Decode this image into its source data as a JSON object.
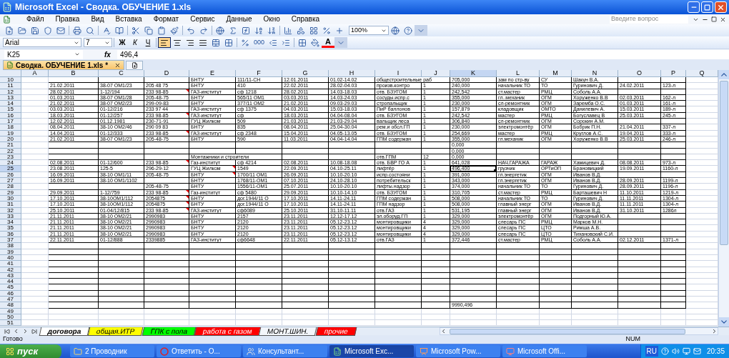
{
  "window": {
    "title": "Microsoft Excel - Сводка. ОБУЧЕНИЕ 1.xls"
  },
  "menu": [
    "Файл",
    "Правка",
    "Вид",
    "Вставка",
    "Формат",
    "Сервис",
    "Данные",
    "Окно",
    "Справка"
  ],
  "help_field": {
    "placeholder": "Введите вопрос"
  },
  "toolbar": {
    "zoom": "100%"
  },
  "format_toolbar": {
    "font": "Arial",
    "size": "7",
    "bold": "Ж",
    "italic": "К",
    "underline": "Ч",
    "thousands": "000",
    "font_color": "A",
    "align_buttons": [
      {
        "selected": true
      },
      {
        "selected": false
      },
      {
        "selected": false
      },
      {
        "selected": false
      }
    ]
  },
  "formula_bar": {
    "name_box": "K25",
    "fx": "fx",
    "value": "496,4"
  },
  "workbook_tab": {
    "label": "Сводка. ОБУЧЕНИЕ 1.xls *"
  },
  "sheet": {
    "columns": [
      {
        "letter": "A",
        "selected": false
      },
      {
        "letter": "B",
        "selected": false
      },
      {
        "letter": "C",
        "selected": false
      },
      {
        "letter": "D",
        "selected": false
      },
      {
        "letter": "E",
        "selected": false
      },
      {
        "letter": "F",
        "selected": false
      },
      {
        "letter": "G",
        "selected": false
      },
      {
        "letter": "H",
        "selected": false
      },
      {
        "letter": "I",
        "selected": false
      },
      {
        "letter": "J",
        "selected": false
      },
      {
        "letter": "K",
        "selected": true
      },
      {
        "letter": "L",
        "selected": false
      },
      {
        "letter": "M",
        "selected": false
      },
      {
        "letter": "N",
        "selected": false
      },
      {
        "letter": "O",
        "selected": false
      },
      {
        "letter": "P",
        "selected": false
      },
      {
        "letter": "Q",
        "selected": false
      }
    ],
    "rows": [
      {
        "number": "10",
        "bordered": true,
        "selected": false,
        "cells": [
          null,
          null,
          null,
          null,
          "БНТУ",
          "111/11-СН",
          "12.01.2011",
          "01.02-14.02",
          "общестроительные раб",
          null,
          "705,000",
          "зам по стр-ву",
          "СУ",
          "Шакун В.А."
        ]
      },
      {
        "number": "11",
        "bordered": true,
        "selected": false,
        "cells": [
          null,
          "21.02.2011",
          "38-07 ОМ1/23",
          "205 48 75",
          "БНТУ",
          "410",
          "22.02.2011",
          "28.02-04.03",
          "произв.контро",
          "1",
          "240,000",
          "начальник ТО",
          "ТО",
          "Гуринович Д.",
          "24.02.2011",
          "123-л"
        ]
      },
      {
        "number": "12",
        "bordered": true,
        "selected": false,
        "cells": [
          null,
          "28.02.2011",
          "1-12/194",
          {
            "text": "233 98-85",
            "comment": true
          },
          "ГАЗ-институт",
          "сф 1218",
          "28.02.2011",
          "14.03-18.03",
          "отв. БЗУГОМ",
          "1",
          "242,542",
          "ст.мастер",
          "РМЦ",
          "Соболь А.А."
        ]
      },
      {
        "number": "13",
        "bordered": true,
        "selected": false,
        "cells": [
          null,
          "01.03.2011",
          "38-07 ОМ1/28",
          "205-48-75",
          "БНТУ",
          "565/11 ОМ1",
          "03.03.2011",
          "14.03-24.03",
          "сосуды.испр.с",
          "1",
          "355,000",
          "гл..механик",
          "ОГМ",
          "Хоруженко В.В",
          "02.03.2011",
          "162-л"
        ]
      },
      {
        "number": "14",
        "bordered": true,
        "selected": false,
        "cells": [
          null,
          "21.02.2011",
          "38-07 ОМ2/23",
          "299-09-83",
          "БНТУ",
          "377/11 ОМ2",
          "21.02.2011",
          "09.03-29.03",
          "стропальщик",
          "1",
          "230,000",
          "сл-ремонтник",
          "ОГМ",
          "Заремба О.С.",
          "01.03.2011",
          "161-л"
        ]
      },
      {
        "number": "15",
        "bordered": true,
        "selected": false,
        "cells": [
          null,
          "03.03.2011",
          "01-12/216",
          "233 97 44",
          "ГАЗ-институт",
          "сф 1375",
          "04.03.2011",
          "15.03-18.03",
          "ПиР баллонов",
          "1",
          "157,879",
          "кладовщик",
          "ОМТО",
          "Данилевич А.",
          "15.03.2011",
          "189-л"
        ]
      },
      {
        "number": "16",
        "bordered": true,
        "selected": false,
        "cells": [
          null,
          "18.03.2011",
          "01-12/257",
          {
            "text": "233 98-85",
            "comment": true
          },
          "ГАЗ-институт",
          "сф",
          "18.03.2011",
          "04.04-08.04",
          "отв. БЗУГОМ",
          "1",
          "242,542",
          "мастер",
          "РМЦ",
          "Богуславец В",
          "25.03.2011",
          "245-л"
        ]
      },
      {
        "number": "17",
        "bordered": true,
        "selected": false,
        "cells": [
          null,
          "12.02.2011",
          "01.12.1981",
          "230-71-91",
          "ГУЦ Жилком",
          "509",
          "21.03.2011",
          "21.03-29.04",
          "вальщик леса",
          "1",
          "306,840",
          "сл-ремонтник",
          "ОГМ",
          "Сорокин А.М."
        ]
      },
      {
        "number": "18",
        "bordered": true,
        "selected": false,
        "cells": [
          null,
          "08.04.2011",
          "38-10 ОМ2/46",
          "290 09 83",
          "БНТУ",
          "835",
          "08.04.2011",
          "25.04-30.04",
          "рем.и обсл.ГП",
          "1",
          "230,000",
          "электромонтёр",
          "ОГМ",
          "Бобрик П.Н.",
          "21.04.2011",
          "337-л"
        ]
      },
      {
        "number": "19",
        "bordered": true,
        "selected": false,
        "cells": [
          null,
          "14.04.2011",
          "01-12/333",
          {
            "text": "233 98-85",
            "comment": true
          },
          "ГАЗ-институт",
          "сф 2348",
          "15.04.2011",
          "04.05-13.05",
          "отв. БЗУГОМ",
          "1",
          "254,669",
          "мастер",
          "РМЦ",
          "Круглов А.С.",
          "19.04.2011",
          "333-л"
        ]
      },
      {
        "number": "20",
        "bordered": true,
        "selected": false,
        "cells": [
          null,
          "21.02.2011",
          "38-07 ОМ1/23",
          "205-48-75",
          "БНТУ",
          "590",
          "11.03.2011",
          "04.04-14.04",
          "ГПМ содержан",
          "1",
          "355,000",
          "гл.механик",
          "ОГМ",
          "Хоруженко В.В",
          "25.03.2011",
          "246-л"
        ]
      },
      {
        "number": "21",
        "bordered": true,
        "selected": false,
        "cells": [
          null,
          null,
          null,
          null,
          null,
          null,
          null,
          null,
          null,
          null,
          "0,000"
        ]
      },
      {
        "number": "22",
        "bordered": true,
        "selected": false,
        "cells": [
          null,
          null,
          null,
          null,
          null,
          null,
          null,
          null,
          null,
          null,
          "0,000"
        ]
      },
      {
        "number": "23",
        "bordered": true,
        "selected": false,
        "cells": [
          null,
          null,
          null,
          null,
          "Монтажники и строители",
          null,
          null,
          null,
          "отв.ГПМ",
          "12",
          "0,000"
        ]
      },
      {
        "number": "24",
        "bordered": true,
        "selected": false,
        "cells": [
          null,
          "02.08.2011",
          "01-12/600",
          {
            "text": "233 98-85",
            "comment": true
          },
          "Газ-институт",
          "сф 4214",
          "02.08.2011",
          "10.08-18.08",
          "отв. БВР ГО А",
          "1",
          "641,028",
          "НАЧ.ГАРАЖА",
          "ГАРАЖ",
          "Хамицевич Д.",
          "08.08.2011",
          "973-л"
        ]
      },
      {
        "number": "25",
        "bordered": true,
        "selected": true,
        "cells": [
          null,
          "23.08.2011",
          "125-5",
          "296-29-12",
          {
            "text": "ГУЦ Жилком",
            "comment": true
          },
          "1549",
          "22.09.2011",
          "04.10-25.11",
          "лифтёр",
          "1",
          "496,400",
          "грузчик",
          "ОРТиОП",
          "Брановицкий",
          "19.09.2011",
          "1160-л"
        ]
      },
      {
        "number": "26",
        "bordered": true,
        "selected": false,
        "cells": [
          null,
          "16.09.2011",
          "38-10 ОМ1/11",
          "205-48-75",
          {
            "text": "БНТУ",
            "comment": true
          },
          "1700/11 ОМ1",
          "26.09.2011",
          "10.10-20.10",
          "испр.состояни",
          "1",
          "391,000",
          "гл.энергетик",
          "ОГМ",
          "Иванов В.Д."
        ]
      },
      {
        "number": "27",
        "bordered": true,
        "selected": false,
        "cells": [
          null,
          "16.09.2011",
          "38-10 ОМ1/1102",
          null,
          "БНТУ",
          "1768/11-ОМ1",
          "07.10.2011",
          "24.10-28.10",
          "потребительск",
          "1",
          "343,000",
          "гл.энергетик",
          "ОГМ",
          "Иванов В.Д.",
          "28.09.2011",
          "1199-л"
        ]
      },
      {
        "number": "28",
        "bordered": true,
        "selected": false,
        "cells": [
          null,
          null,
          null,
          "205-48-75",
          "БНТУ",
          "1556/11-ОМ1",
          "25.07.2011",
          "10.10-20.10",
          "лифты.надзор",
          "1",
          "374,000",
          "начальник ТО",
          "ТО",
          "Гуринович Д.",
          "28.09.2011",
          "1196-л"
        ]
      },
      {
        "number": "29",
        "bordered": true,
        "selected": false,
        "cells": [
          null,
          "29.09.2011",
          "1-12/759",
          {
            "text": "233 98-85",
            "comment": true
          },
          "Газ-институт",
          "сф 5480",
          "29.09.2011",
          "10.10-14.10",
          "отв. БЗУГОМ",
          "1",
          "310,705",
          "ст.мастер",
          "РМЦ",
          "Барташевич Н",
          "11.10.2011",
          "1219-л"
        ]
      },
      {
        "number": "30",
        "bordered": true,
        "selected": false,
        "cells": [
          null,
          "17.10.2011",
          "38-10ОМ1/112",
          {
            "text": "2054875",
            "comment": true
          },
          "БНТУ",
          "дог.1944/11 О",
          "17.10.2011",
          "14.11-24.11",
          "ГПМ содержан",
          "1",
          "508,000",
          "начальник ТО",
          "ТО",
          "Гуринович Д.",
          "11.11.2011",
          "1304-л"
        ]
      },
      {
        "number": "31",
        "bordered": true,
        "selected": false,
        "cells": [
          null,
          "17.10.2011",
          "38-10ОМ1/112",
          {
            "text": "2054875",
            "comment": true
          },
          "БНТУ",
          "дог.1944/11 О",
          "17.10.2011",
          "14.11-24.11",
          "ГПМ надзор",
          "1",
          "508,000",
          "главный энерг",
          "ОГМ",
          "Иванов В.Д.",
          "11.11.2011",
          "1304-л"
        ]
      },
      {
        "number": "32",
        "bordered": true,
        "selected": false,
        "cells": [
          null,
          "25.10.2011",
          "01-04/12/815",
          {
            "text": "233 98-85",
            "comment": true
          },
          "ГАЗ-институт",
          "сф6089",
          "25.10.2011",
          "31.10-11.11",
          "отв.ГАЗ",
          "1",
          "531,195",
          "главный энерг",
          "ОГМ",
          "Иванов В.Д.",
          "31.10.2011",
          "1286л"
        ]
      },
      {
        "number": "33",
        "bordered": true,
        "selected": false,
        "cells": [
          null,
          "21.11.2011",
          "38-10 ОМ2/21",
          "2990983",
          "БНТУ",
          "2157",
          "23.11.2011",
          "12.12-17.12",
          "эл.оборуд.ГП",
          "1",
          "329,000",
          "электромонтёр",
          "ОГМ",
          "Подгорный Ю.А."
        ]
      },
      {
        "number": "34",
        "bordered": true,
        "selected": false,
        "cells": [
          null,
          "21.11.2011",
          "38-10 ОМ2/21",
          "2990983",
          "БНТУ",
          "2120",
          "23.11.2011",
          "05.12-23.12",
          "монтировщики",
          "4",
          "329,000",
          "слесарь ПС",
          "РМЦ",
          "Марков М.Н."
        ]
      },
      {
        "number": "35",
        "bordered": true,
        "selected": false,
        "cells": [
          null,
          "21.11.2011",
          "38-10 ОМ2/21",
          "2990983",
          "БНТУ",
          "2120",
          "23.11.2011",
          "05.12-23.12",
          "монтировщики",
          "4",
          "329,000",
          "слесарь ПС",
          "ЦТО",
          "Римша А.В."
        ]
      },
      {
        "number": "36",
        "bordered": true,
        "selected": false,
        "cells": [
          null,
          "21.11.2011",
          "38-10 ОМ2/21",
          "2990983",
          "БНТУ",
          "2120",
          "23.11.2011",
          "05.12-23.12",
          "монтировщики",
          "4",
          "329,000",
          "слесарь ПС",
          "ЦТО",
          "Тихановский С.И."
        ]
      },
      {
        "number": "37",
        "bordered": true,
        "selected": false,
        "cells": [
          null,
          "22.11.2011",
          "01-12/888",
          "2339885",
          "ГАЗ-институт",
          "сф6648",
          "22.11.2011",
          "05.12-13.12",
          "отв.ГАЗ",
          "1",
          "372,446",
          "ст.мастер",
          "РМЦ",
          "Соболь А.А.",
          "02.12.2011",
          "1371-л"
        ]
      },
      {
        "number": "38",
        "bordered": true,
        "selected": false
      },
      {
        "number": "39",
        "bordered": true,
        "selected": false
      },
      {
        "number": "40",
        "bordered": true,
        "selected": false
      },
      {
        "number": "41",
        "bordered": true,
        "selected": false
      },
      {
        "number": "42",
        "bordered": true,
        "selected": false
      },
      {
        "number": "43",
        "bordered": true,
        "selected": false
      },
      {
        "number": "44",
        "bordered": true,
        "selected": false
      },
      {
        "number": "45",
        "bordered": true,
        "selected": false
      },
      {
        "number": "46",
        "bordered": true,
        "selected": false
      },
      {
        "number": "47",
        "bordered": true,
        "selected": false
      },
      {
        "number": "48",
        "bordered": true,
        "selected": false,
        "cells": [
          null,
          null,
          null,
          null,
          null,
          null,
          null,
          null,
          null,
          null,
          "9990,496"
        ]
      },
      {
        "number": "49",
        "bordered": false,
        "selected": false
      },
      {
        "number": "50",
        "bordered": false,
        "selected": false
      },
      {
        "number": "51",
        "bordered": false,
        "selected": false
      }
    ]
  },
  "sheet_tabs": [
    {
      "label": "договора",
      "selected": true
    },
    {
      "label": "общая.ИТР",
      "selected": false,
      "color": "#ffff00"
    },
    {
      "label": "ГПК с пола",
      "selected": false,
      "color": "#00ff00"
    },
    {
      "label": "работа с газом",
      "selected": false,
      "color": "#ff0000"
    },
    {
      "label": "МОНТ.ШИН.",
      "selected": false
    },
    {
      "label": "прочие",
      "selected": false,
      "color": "#ff0000"
    }
  ],
  "status_bar": {
    "left": "Готово",
    "right": "NUM"
  },
  "taskbar": {
    "start": "пуск",
    "tasks": [
      {
        "label": "2 Проводник",
        "kind": "folder",
        "selected": false
      },
      {
        "label": "Ответить - О...",
        "kind": "browser",
        "selected": false
      },
      {
        "label": "Консультант...",
        "kind": "consultant",
        "selected": false
      },
      {
        "label": "Microsoft Exc...",
        "kind": "excel",
        "selected": true
      },
      {
        "label": "Microsoft Pow...",
        "kind": "powerpoint",
        "selected": false
      },
      {
        "label": "Microsoft Offi...",
        "kind": "office",
        "selected": false
      }
    ],
    "language": "RU",
    "time": "20:35"
  }
}
